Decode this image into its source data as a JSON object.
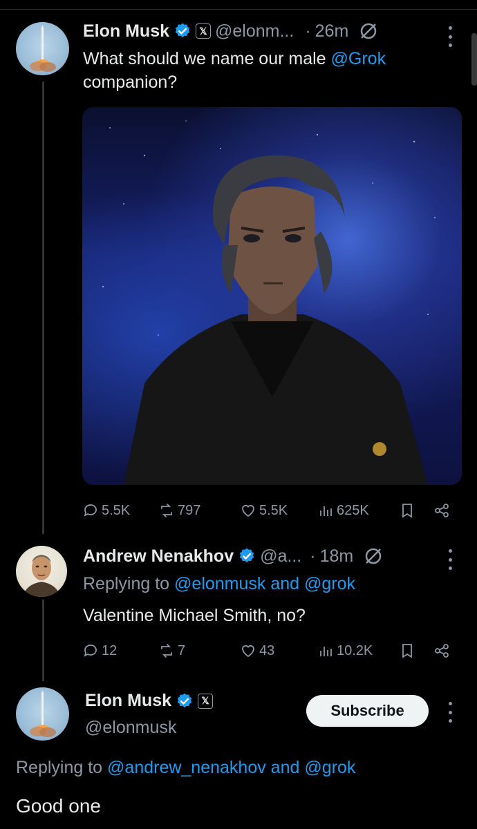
{
  "tweet": {
    "author_name": "Elon Musk",
    "handle": "@elonm...",
    "separator": "·",
    "time": "26m",
    "text_before": "What should we name our male ",
    "mention": "@Grok",
    "text_after": "companion?",
    "stats": {
      "replies": "5.5K",
      "reposts": "797",
      "likes": "5.5K",
      "views": "625K"
    }
  },
  "reply": {
    "author_name": "Andrew Nenakhov",
    "handle": "@a...",
    "separator": "·",
    "time": "18m",
    "replying_prefix": "Replying to ",
    "replying_mentions": "@elonmusk and @grok",
    "text": "Valentine Michael Smith, no?",
    "stats": {
      "replies": "12",
      "reposts": "7",
      "likes": "43",
      "views": "10.2K"
    }
  },
  "main": {
    "author_name": "Elon Musk",
    "handle": "@elonmusk",
    "subscribe_label": "Subscribe",
    "replying_prefix": "Replying to ",
    "replying_mentions": "@andrew_nenakhov and @grok",
    "text": "Good one"
  },
  "colors": {
    "accent": "#1d9bf0",
    "muted": "#8b98a5",
    "background": "#000000"
  },
  "icons": [
    "verified-badge-icon",
    "x-logo-icon",
    "grok-sparkle-icon",
    "more-icon",
    "reply-icon",
    "repost-icon",
    "like-icon",
    "views-icon",
    "bookmark-icon",
    "share-icon"
  ]
}
